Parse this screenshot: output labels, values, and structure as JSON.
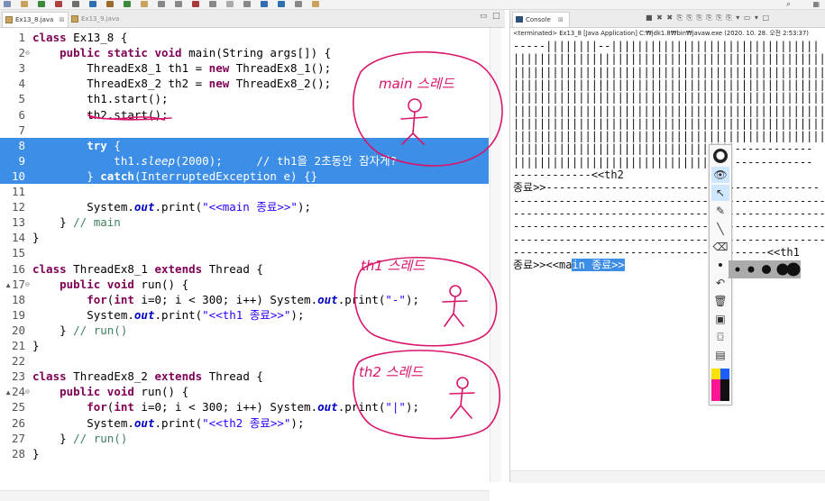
{
  "ide": {
    "search_icon": "search-icon",
    "perspective_icon": "perspective-icon"
  },
  "editor": {
    "tabs": [
      {
        "label": "Ex13_8.java",
        "close": "⊠",
        "active": true
      },
      {
        "label": "Ex13_9.java",
        "close": "",
        "active": false
      }
    ],
    "window_controls": {
      "minimize": "▭",
      "maximize": "□"
    },
    "lines": [
      {
        "n": "1",
        "fold": "",
        "html": "<span class='kw'>class</span> Ex13_8 {"
      },
      {
        "n": "2",
        "fold": "⊖",
        "html": "    <span class='kw'>public</span> <span class='kw'>static</span> <span class='kw'>void</span> main(String args[]) {"
      },
      {
        "n": "3",
        "fold": "",
        "html": "        ThreadEx8_1 th1 = <span class='kw'>new</span> ThreadEx8_1();"
      },
      {
        "n": "4",
        "fold": "",
        "html": "        ThreadEx8_2 th2 = <span class='kw'>new</span> ThreadEx8_2();"
      },
      {
        "n": "5",
        "fold": "",
        "html": "        th1.start();"
      },
      {
        "n": "6",
        "fold": "",
        "html": "        th2.start();"
      },
      {
        "n": "7",
        "fold": "",
        "html": ""
      },
      {
        "n": "8",
        "fold": "",
        "sel": true,
        "html": "        <span class='kw'>try</span> {"
      },
      {
        "n": "9",
        "fold": "",
        "sel": true,
        "html": "            th1.<span class='sfn'>sleep</span>(2000);     <span class='cmt'>// th1을 2초동안 잠자게?</span>"
      },
      {
        "n": "10",
        "fold": "",
        "sel": true,
        "html": "        } <span class='kw'>catch</span>(InterruptedException e) {}"
      },
      {
        "n": "11",
        "fold": "",
        "html": ""
      },
      {
        "n": "12",
        "fold": "",
        "html": "        System.<span class='fld'>out</span>.print(<span class='str'>\"&lt;&lt;main 종료&gt;&gt;\"</span>);"
      },
      {
        "n": "13",
        "fold": "",
        "html": "    } <span class='cmt'>// main</span>"
      },
      {
        "n": "14",
        "fold": "",
        "html": "}"
      },
      {
        "n": "15",
        "fold": "",
        "html": ""
      },
      {
        "n": "16",
        "fold": "",
        "html": "<span class='kw'>class</span> ThreadEx8_1 <span class='kw'>extends</span> Thread {"
      },
      {
        "n": "▴17",
        "fold": "⊖",
        "html": "    <span class='kw'>public</span> <span class='kw'>void</span> run() {"
      },
      {
        "n": "18",
        "fold": "",
        "html": "        <span class='kw'>for</span>(<span class='kw'>int</span> i=0; i &lt; 300; i++) System.<span class='fld'>out</span>.print(<span class='str'>\"-\"</span>);"
      },
      {
        "n": "19",
        "fold": "",
        "html": "        System.<span class='fld'>out</span>.print(<span class='str'>\"&lt;&lt;th1 종료&gt;&gt;\"</span>);"
      },
      {
        "n": "20",
        "fold": "",
        "html": "    } <span class='cmt'>// run()</span>"
      },
      {
        "n": "21",
        "fold": "",
        "html": "}"
      },
      {
        "n": "22",
        "fold": "",
        "html": ""
      },
      {
        "n": "23",
        "fold": "",
        "html": "<span class='kw'>class</span> ThreadEx8_2 <span class='kw'>extends</span> Thread {"
      },
      {
        "n": "▴24",
        "fold": "⊖",
        "html": "    <span class='kw'>public</span> <span class='kw'>void</span> run() {"
      },
      {
        "n": "25",
        "fold": "",
        "html": "        <span class='kw'>for</span>(<span class='kw'>int</span> i=0; i &lt; 300; i++) System.<span class='fld'>out</span>.print(<span class='str'>\"|\"</span>);"
      },
      {
        "n": "26",
        "fold": "",
        "html": "        System.<span class='fld'>out</span>.print(<span class='str'>\"&lt;&lt;th2 종료&gt;&gt;\"</span>);"
      },
      {
        "n": "27",
        "fold": "",
        "html": "    } <span class='cmt'>// run()</span>"
      },
      {
        "n": "28",
        "fold": "",
        "html": "}"
      }
    ]
  },
  "console": {
    "tab_label": "Console",
    "close": "⊠",
    "toolbar_icons": "■ ✖ ✖ ⎘ ⎘ ⎘ ⎘ ⎘ ⎘ ▾ ▭ ▾ □",
    "terminated": "<terminated> Ex13_8 [Java Application] C:₩jdk1.8₩bin₩javaw.exe (2020. 10. 28. 오전 2:53:37)",
    "output": [
      {
        "text": "-----||||||||--||||||||||||||||||||||||||||||||"
      },
      {
        "text": "||||||||||||||||||||||||||||||||||||||||||||||||"
      },
      {
        "text": "||||||||||||||||||||||||||||||||||||||||||||||||"
      },
      {
        "text": "||||||||||||||||||||||||||||||||||||||||||||||||"
      },
      {
        "text": "||||||||||||||||||||||||||||||||||||||||||||||||"
      },
      {
        "text": "||||||||||||||||||||||||||||||||||||||||||||||||"
      },
      {
        "text": "||||||||||||||||||||||||||||||||||||||||||||||||"
      },
      {
        "text": "||||||||||||||||||||||||||||||||||||||||||||||||"
      },
      {
        "text": "||||||||||||||||||||||||||||||||||------------"
      },
      {
        "text": "||||||||||||||||||||||||||||||||||------------"
      },
      {
        "text": "------------<<th2"
      },
      {
        "text": "종료>>------------------------------------------"
      },
      {
        "text": "------------------------------------------------"
      },
      {
        "text": "------------------------------------------------"
      },
      {
        "text": "------------------------------------------------"
      },
      {
        "text": "------------------------------------------------"
      },
      {
        "text": "---------------------------------------<<th1"
      },
      {
        "text": "종료>><<ma",
        "highlight": "in 종료>>"
      }
    ]
  },
  "annotations": {
    "main": "main 스레드",
    "th1": "th1 스레드",
    "th2": "th2 스레드"
  },
  "pen_tool": {
    "tools": [
      {
        "name": "app-logo-icon",
        "glyph": "⬤",
        "active": false
      },
      {
        "name": "eye-icon",
        "glyph": "👁",
        "active": true
      },
      {
        "name": "cursor-arrow-icon",
        "glyph": "↖",
        "active": true
      },
      {
        "name": "pen-icon",
        "glyph": "✎",
        "active": false
      },
      {
        "name": "line-icon",
        "glyph": "╲",
        "active": false
      },
      {
        "name": "eraser-icon",
        "glyph": "⌫",
        "active": false
      },
      {
        "name": "dot-size-icon",
        "glyph": "•",
        "active": false
      },
      {
        "name": "undo-icon",
        "glyph": "↶",
        "active": false
      },
      {
        "name": "trash-icon",
        "glyph": "🗑",
        "active": false
      },
      {
        "name": "board-icon",
        "glyph": "▣",
        "active": false
      },
      {
        "name": "camera-icon",
        "glyph": "⌼",
        "active": false
      },
      {
        "name": "document-icon",
        "glyph": "▤",
        "active": false
      }
    ],
    "palette_colors": [
      "#ffe000",
      "#1d5cff",
      "#ff1493",
      "#111111",
      "#ff1493",
      "#111111"
    ]
  },
  "colors": {
    "ink": "#d8156b",
    "selection": "#3d8ee6",
    "keyword": "#7f0055",
    "string": "#2a00ff",
    "comment": "#3f7f5f"
  }
}
